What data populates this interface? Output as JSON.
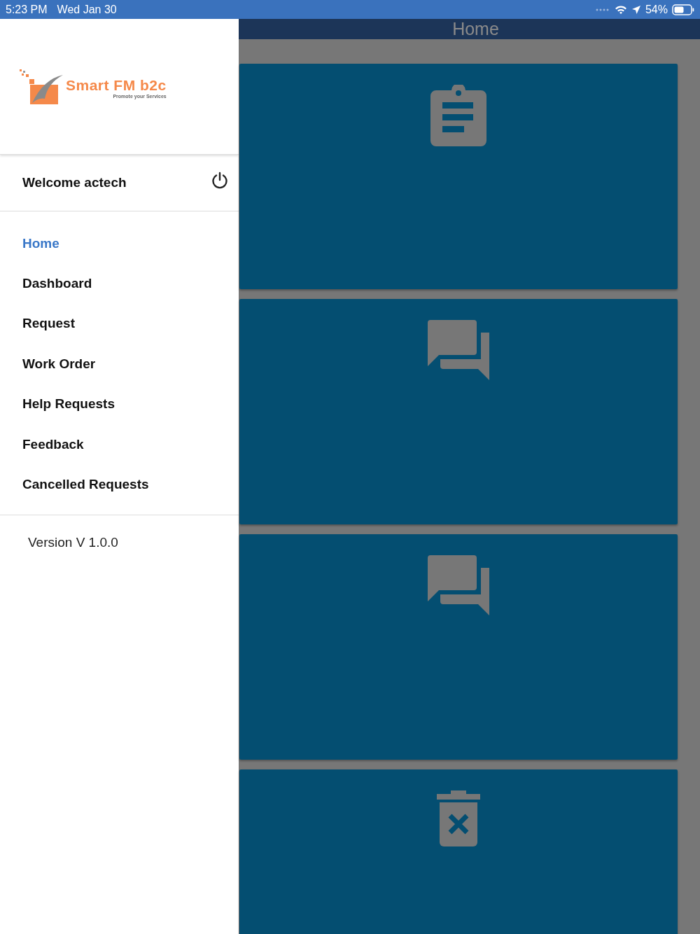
{
  "status_bar": {
    "time": "5:23 PM",
    "date": "Wed Jan 30",
    "battery": "54%"
  },
  "drawer": {
    "logo": {
      "name": "Smart FM b2c",
      "tagline": "Promote your Services"
    },
    "welcome": "Welcome actech",
    "menu": [
      {
        "label": "Home",
        "selected": true
      },
      {
        "label": "Dashboard",
        "selected": false
      },
      {
        "label": "Request",
        "selected": false
      },
      {
        "label": "Work Order",
        "selected": false
      },
      {
        "label": "Help Requests",
        "selected": false
      },
      {
        "label": "Feedback",
        "selected": false
      },
      {
        "label": "Cancelled Requests",
        "selected": false
      }
    ],
    "version": "Version V 1.0.0"
  },
  "header": {
    "title": "Home"
  },
  "cards": [
    {
      "kind": "clipboard"
    },
    {
      "kind": "chat"
    },
    {
      "kind": "chat"
    },
    {
      "kind": "trash"
    }
  ]
}
